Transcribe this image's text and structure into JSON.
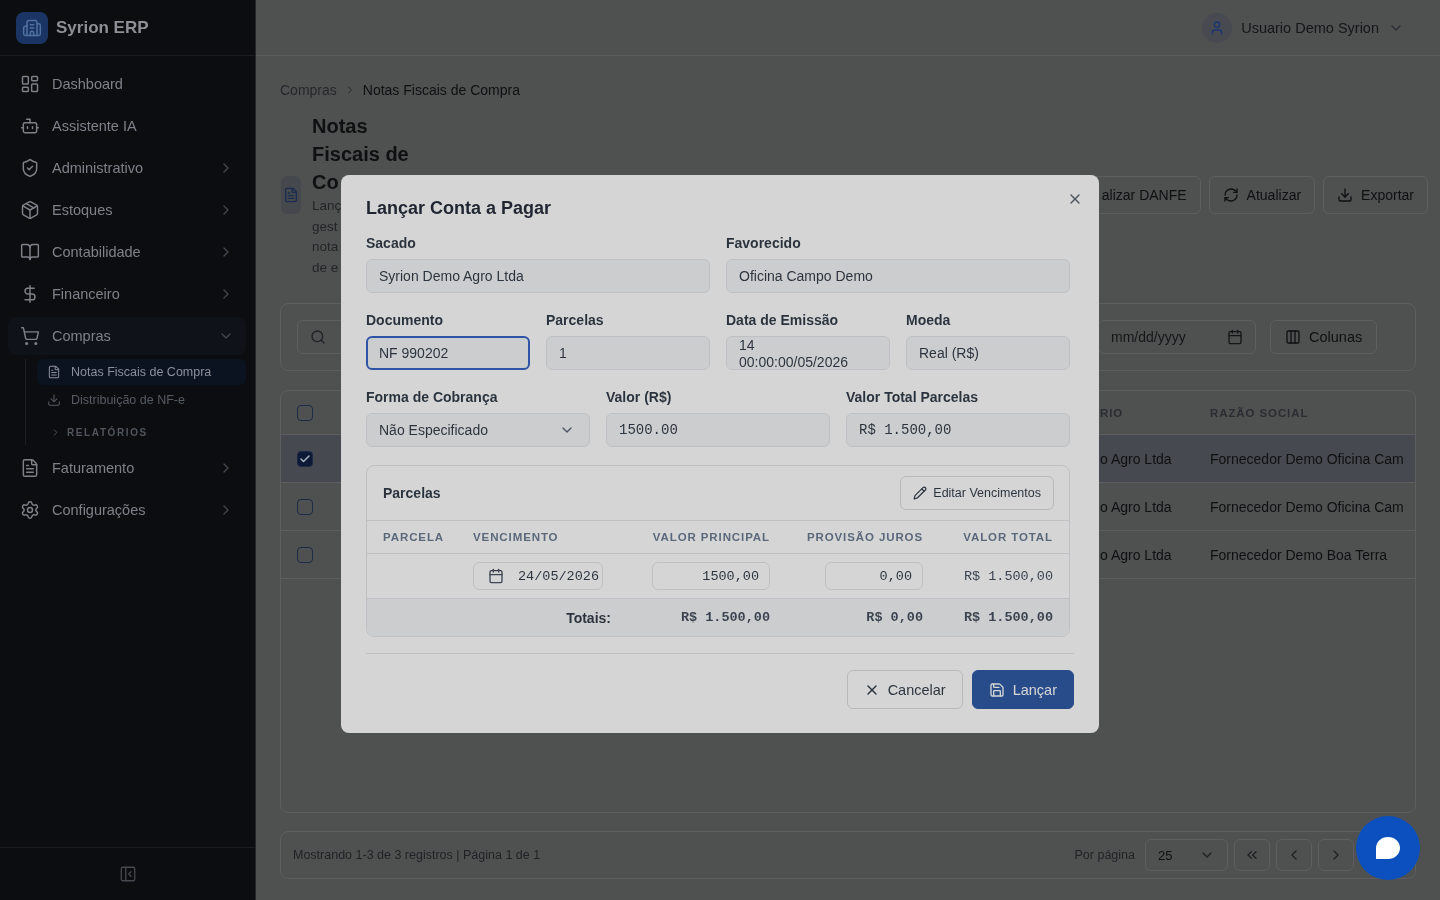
{
  "sidebar": {
    "app_name": "Syrion ERP",
    "items": [
      {
        "label": "Dashboard",
        "kind": "link",
        "selected": false
      },
      {
        "label": "Assistente IA",
        "kind": "link",
        "selected": false
      },
      {
        "label": "Administrativo",
        "kind": "group",
        "selected": false,
        "expanded": false
      },
      {
        "label": "Estoques",
        "kind": "group",
        "selected": false,
        "expanded": false
      },
      {
        "label": "Contabilidade",
        "kind": "group",
        "selected": false,
        "expanded": false
      },
      {
        "label": "Financeiro",
        "kind": "group",
        "selected": false,
        "expanded": false
      },
      {
        "label": "Compras",
        "kind": "group",
        "selected": false,
        "expanded": true,
        "children": [
          {
            "label": "Notas Fiscais de Compra",
            "kind": "link",
            "selected": true
          },
          {
            "label": "Distribuição de NF-e",
            "kind": "link",
            "selected": false
          },
          {
            "label": "RELATÓRIOS",
            "kind": "section",
            "expanded": false
          }
        ]
      },
      {
        "label": "Faturamento",
        "kind": "group",
        "selected": false,
        "expanded": false
      },
      {
        "label": "Configurações",
        "kind": "group",
        "selected": false,
        "expanded": false
      }
    ]
  },
  "header": {
    "user_name": "Usuario Demo Syrion"
  },
  "breadcrumb": [
    {
      "label": "Compras",
      "current": false
    },
    {
      "label": "Notas Fiscais de Compra",
      "current": true
    }
  ],
  "page": {
    "title": "Notas Fiscais de Co",
    "description_lines": [
      "Lanç",
      "gest",
      "nota",
      "de e"
    ]
  },
  "toolbar": [
    {
      "label": "alizar DANFE"
    },
    {
      "label": "Atualizar"
    },
    {
      "label": "Exportar"
    }
  ],
  "filters": {
    "date_to": {
      "placeholder": "mm/dd/yyyy"
    },
    "columns_button": "Colunas"
  },
  "table": {
    "select_all": {
      "checked": false
    },
    "columns": [
      "RIO",
      "RAZÃO SOCIAL"
    ],
    "rows": [
      {
        "selected": true,
        "cells": [
          "o Agro Ltda",
          "Fornecedor Demo Oficina Cam"
        ]
      },
      {
        "selected": false,
        "cells": [
          "o Agro Ltda",
          "Fornecedor Demo Oficina Cam"
        ]
      },
      {
        "selected": false,
        "cells": [
          "o Agro Ltda",
          "Fornecedor Demo Boa Terra"
        ]
      }
    ]
  },
  "pagination": {
    "summary": "Mostrando 1-3 de 3 registros | Página 1 de 1",
    "per_page_label": "Por página",
    "per_page": "25"
  },
  "dialog": {
    "title": "Lançar Conta a Pagar",
    "field_rows": [
      [
        {
          "label": "Sacado",
          "value": "Syrion Demo Agro Ltda",
          "kind": "text",
          "focused": false
        },
        {
          "label": "Favorecido",
          "value": "Oficina Campo Demo",
          "kind": "text",
          "focused": false
        }
      ],
      [
        {
          "label": "Documento",
          "value": "NF 990202",
          "kind": "text",
          "focused": true
        },
        {
          "label": "Parcelas",
          "value": "1",
          "kind": "text",
          "focused": false
        },
        {
          "label": "Data de Emissão",
          "value": "14 00:00:00/05/2026",
          "kind": "multiline",
          "focused": false
        },
        {
          "label": "Moeda",
          "value": "Real (R$)",
          "kind": "text",
          "focused": false
        }
      ],
      [
        {
          "label": "Forma de Cobrança",
          "value": "Não Especificado",
          "kind": "select",
          "focused": false
        },
        {
          "label": "Valor (R$)",
          "value": "1500.00",
          "kind": "amount",
          "focused": false
        },
        {
          "label": "Valor Total Parcelas",
          "value": "R$ 1.500,00",
          "kind": "amount",
          "focused": false
        }
      ]
    ],
    "installments": {
      "title": "Parcelas",
      "edit_button": "Editar Vencimentos",
      "columns": [
        "PARCELA",
        "VENCIMENTO",
        "VALOR PRINCIPAL",
        "PROVISÃO JUROS",
        "VALOR TOTAL"
      ],
      "rows": [
        {
          "due_date": "24/05/2026",
          "principal": "1500,00",
          "interest": "0,00",
          "total": "R$ 1.500,00"
        }
      ],
      "totals": {
        "label": "Totais:",
        "principal": "R$ 1.500,00",
        "interest": "R$ 0,00",
        "total": "R$ 1.500,00"
      }
    },
    "buttons": [
      {
        "label": "Cancelar",
        "kind": "secondary"
      },
      {
        "label": "Lançar",
        "kind": "primary"
      }
    ]
  }
}
